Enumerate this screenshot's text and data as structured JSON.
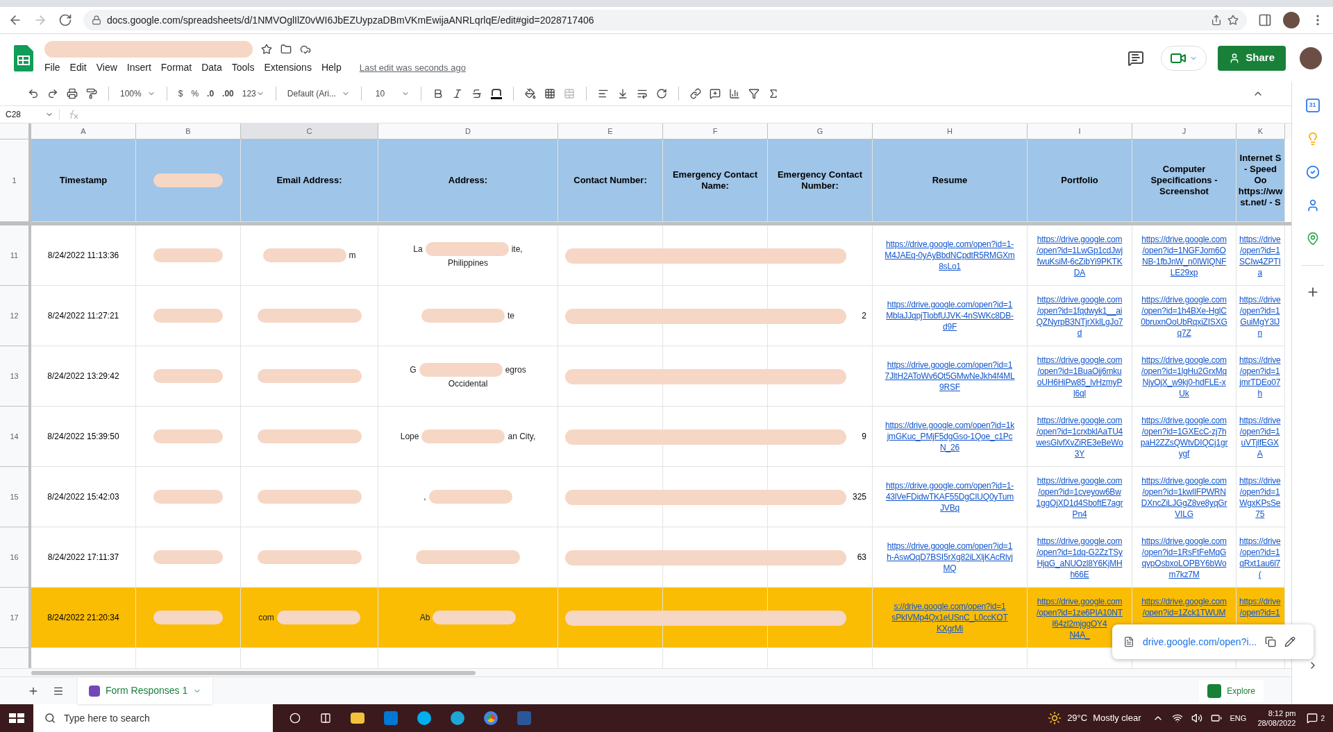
{
  "browser": {
    "url": "docs.google.com/spreadsheets/d/1NMVOglIlZ0vWI6JbEZUypzaDBmVKmEwijaANRLqrlqE/edit#gid=2028717406"
  },
  "doc": {
    "menu": [
      "File",
      "Edit",
      "View",
      "Insert",
      "Format",
      "Data",
      "Tools",
      "Extensions",
      "Help"
    ],
    "last_edit": "Last edit was seconds ago",
    "share": "Share"
  },
  "toolbar": {
    "zoom": "100%",
    "currency": "$",
    "percent": "%",
    "dec_less": ".0",
    "dec_more": ".00",
    "number_format": "123",
    "font": "Default (Ari...",
    "size": "10"
  },
  "formula_bar": {
    "cell": "C28"
  },
  "columns": [
    {
      "label": "A",
      "selected": false
    },
    {
      "label": "B",
      "selected": false
    },
    {
      "label": "C",
      "selected": true
    },
    {
      "label": "D",
      "selected": false
    },
    {
      "label": "E",
      "selected": false
    },
    {
      "label": "F",
      "selected": false
    },
    {
      "label": "G",
      "selected": false
    },
    {
      "label": "H",
      "selected": false
    },
    {
      "label": "I",
      "selected": false
    },
    {
      "label": "J",
      "selected": false
    },
    {
      "label": "K",
      "selected": false
    }
  ],
  "header_row": {
    "number": "1",
    "cells": [
      {
        "kind": "text",
        "lines": [
          "Timestamp"
        ]
      },
      {
        "kind": "redacted"
      },
      {
        "kind": "text",
        "lines": [
          "Email Address:"
        ]
      },
      {
        "kind": "text",
        "lines": [
          "Address:"
        ]
      },
      {
        "kind": "text",
        "lines": [
          "Contact Number:"
        ]
      },
      {
        "kind": "text",
        "lines": [
          "Emergency Contact",
          "Name:"
        ]
      },
      {
        "kind": "text",
        "lines": [
          "Emergency Contact",
          "Number:"
        ]
      },
      {
        "kind": "text",
        "lines": [
          "Resume"
        ]
      },
      {
        "kind": "text",
        "lines": [
          "Portfolio"
        ]
      },
      {
        "kind": "text",
        "lines": [
          "Computer",
          "Specifications -",
          "Screenshot"
        ]
      },
      {
        "kind": "text",
        "lines": [
          "Internet S",
          "- Speed",
          "Oo",
          "https://ww",
          "st.net/ - S"
        ]
      }
    ]
  },
  "rows": [
    {
      "number": "11",
      "highlighted": false,
      "cells": [
        {
          "kind": "text",
          "lines": [
            "8/24/2022 11:13:36"
          ]
        },
        {
          "kind": "redacted"
        },
        {
          "kind": "mixed",
          "lines": [
            {
              "after": "m"
            }
          ]
        },
        {
          "kind": "mixed",
          "lines": [
            {
              "before": "La",
              "after": "ite,"
            },
            {
              "text": "Philippines"
            }
          ]
        },
        {
          "kind": "redacted_span"
        },
        {
          "kind": "empty"
        },
        {
          "kind": "empty"
        },
        {
          "kind": "link",
          "lines": [
            "https://drive.google.com/open?id=1-",
            "M4JAEq-0yAyBbdNCpdtR5RMGXm",
            "8sLo1"
          ]
        },
        {
          "kind": "link",
          "lines": [
            "https://drive.google.com",
            "/open?id=1LwGp1cdJwj",
            "fwuKsiM-6cZibYi9PKTK",
            "DA"
          ]
        },
        {
          "kind": "link",
          "lines": [
            "https://drive.google.com",
            "/open?id=1NGFJom6O",
            "NB-1fbJnW_n0IWIQNF",
            "LE29xp"
          ]
        },
        {
          "kind": "link",
          "lines": [
            "https://drive",
            "/open?id=1",
            "SCIw4ZPTI",
            "a"
          ]
        }
      ]
    },
    {
      "number": "12",
      "highlighted": false,
      "cells": [
        {
          "kind": "text",
          "lines": [
            "8/24/2022 11:27:21"
          ]
        },
        {
          "kind": "redacted"
        },
        {
          "kind": "redacted"
        },
        {
          "kind": "mixed",
          "lines": [
            {
              "after": "te"
            }
          ]
        },
        {
          "kind": "redacted_span"
        },
        {
          "kind": "empty"
        },
        {
          "kind": "text_right",
          "lines": [
            "2"
          ]
        },
        {
          "kind": "link",
          "lines": [
            "https://drive.google.com/open?id=1",
            "MblaJJqpjTlobfUJVK-4nSWKc8DB-",
            "d9F"
          ]
        },
        {
          "kind": "link",
          "lines": [
            "https://drive.google.com",
            "/open?id=1fqdwyk1__ai",
            "QZNyrpB3NTjrXklLgJo7",
            "d"
          ]
        },
        {
          "kind": "link",
          "lines": [
            "https://drive.google.com",
            "/open?id=1h4BXe-HglC",
            "0bruxnOoUbRqxiZISXG",
            "q7Z"
          ]
        },
        {
          "kind": "link",
          "lines": [
            "https://drive",
            "/open?id=1",
            "GuiMgY3lJ",
            "n"
          ]
        }
      ]
    },
    {
      "number": "13",
      "highlighted": false,
      "cells": [
        {
          "kind": "text",
          "lines": [
            "8/24/2022 13:29:42"
          ]
        },
        {
          "kind": "redacted"
        },
        {
          "kind": "redacted"
        },
        {
          "kind": "mixed",
          "lines": [
            {
              "before": "G",
              "after": "egros"
            },
            {
              "text": "Occidental"
            }
          ]
        },
        {
          "kind": "redacted_span"
        },
        {
          "kind": "empty"
        },
        {
          "kind": "empty"
        },
        {
          "kind": "link",
          "lines": [
            "https://drive.google.com/open?id=1",
            "7JltH2AToWv6Ot5GMwNeJkh4f4ML",
            "9RSF"
          ]
        },
        {
          "kind": "link",
          "lines": [
            "https://drive.google.com",
            "/open?id=1BuaOjj6mku",
            "oUH6HiPw85_lvHzmyP",
            "l6ql"
          ]
        },
        {
          "kind": "link",
          "lines": [
            "https://drive.google.com",
            "/open?id=1lgHu2GrxMq",
            "NjyOjX_w9kj0-hdFLE-x",
            "Uk"
          ]
        },
        {
          "kind": "link",
          "lines": [
            "https://drive",
            "/open?id=1",
            "jmrTDEo07",
            "h"
          ]
        }
      ]
    },
    {
      "number": "14",
      "highlighted": false,
      "cells": [
        {
          "kind": "text",
          "lines": [
            "8/24/2022 15:39:50"
          ]
        },
        {
          "kind": "redacted"
        },
        {
          "kind": "redacted"
        },
        {
          "kind": "mixed",
          "lines": [
            {
              "before": "Lope",
              "after": "an City,"
            }
          ]
        },
        {
          "kind": "redacted_span"
        },
        {
          "kind": "empty"
        },
        {
          "kind": "text_right",
          "lines": [
            "9"
          ]
        },
        {
          "kind": "link",
          "lines": [
            "https://drive.google.com/open?id=1k",
            "jmGKuc_PMjF5dgGso-1Qoe_c1Pc",
            "N_26"
          ]
        },
        {
          "kind": "link",
          "lines": [
            "https://drive.google.com",
            "/open?id=1crxbklAaTU4",
            "wesGlvfXvZiRE3eBeWo",
            "3Y"
          ]
        },
        {
          "kind": "link",
          "lines": [
            "https://drive.google.com",
            "/open?id=1GXEcC-zj7h",
            "paH2ZZsQWtvDIQCj1gr",
            "ygf"
          ]
        },
        {
          "kind": "link",
          "lines": [
            "https://drive",
            "/open?id=1",
            "uVTjlfEGX",
            "A"
          ]
        }
      ]
    },
    {
      "number": "15",
      "highlighted": false,
      "cells": [
        {
          "kind": "text",
          "lines": [
            "8/24/2022 15:42:03"
          ]
        },
        {
          "kind": "redacted"
        },
        {
          "kind": "redacted"
        },
        {
          "kind": "mixed",
          "lines": [
            {
              "before": ","
            }
          ]
        },
        {
          "kind": "redacted_span"
        },
        {
          "kind": "empty"
        },
        {
          "kind": "text_right",
          "lines": [
            "325"
          ]
        },
        {
          "kind": "link",
          "lines": [
            "https://drive.google.com/open?id=1-",
            "43lVeFDidwTKAF55DgCIUQ0yTum",
            "JVBq"
          ]
        },
        {
          "kind": "link",
          "lines": [
            "https://drive.google.com",
            "/open?id=1cveyow6Bw",
            "1ggOjXD1d4SboftE7agr",
            "Pn4"
          ]
        },
        {
          "kind": "link",
          "lines": [
            "https://drive.google.com",
            "/open?id=1kwlIFPWRN",
            "DXncZiLJGgZ8ve8yqGr",
            "VILG"
          ]
        },
        {
          "kind": "link",
          "lines": [
            "https://drive",
            "/open?id=1",
            "WgxKPsSe",
            "75"
          ]
        }
      ]
    },
    {
      "number": "16",
      "highlighted": false,
      "cells": [
        {
          "kind": "text",
          "lines": [
            "8/24/2022 17:11:37"
          ]
        },
        {
          "kind": "redacted"
        },
        {
          "kind": "redacted"
        },
        {
          "kind": "redacted"
        },
        {
          "kind": "redacted_span"
        },
        {
          "kind": "empty"
        },
        {
          "kind": "text_right",
          "lines": [
            "63"
          ]
        },
        {
          "kind": "link",
          "lines": [
            "https://drive.google.com/open?id=1",
            "h-AswOqD7BSI5rXg82iLXljKAcRlvj",
            "MQ"
          ]
        },
        {
          "kind": "link",
          "lines": [
            "https://drive.google.com",
            "/open?id=1dq-G2ZzTSy",
            "HjqG_aNUOzl8Y6KjMH",
            "h66E"
          ]
        },
        {
          "kind": "link",
          "lines": [
            "https://drive.google.com",
            "/open?id=1RsFtFeMqG",
            "qvpOsbxoLOPBY6bWo",
            "m7kz7M"
          ]
        },
        {
          "kind": "link",
          "lines": [
            "https://drive",
            "/open?id=1",
            "qRxt1au6l7",
            "("
          ]
        }
      ]
    },
    {
      "number": "17",
      "highlighted": true,
      "cells": [
        {
          "kind": "text",
          "lines": [
            "8/24/2022 21:20:34"
          ]
        },
        {
          "kind": "redacted"
        },
        {
          "kind": "mixed",
          "lines": [
            {
              "before": "com"
            }
          ]
        },
        {
          "kind": "mixed",
          "lines": [
            {
              "before": "Ab"
            }
          ]
        },
        {
          "kind": "redacted_span"
        },
        {
          "kind": "empty"
        },
        {
          "kind": "empty"
        },
        {
          "kind": "link",
          "lines": [
            "s://drive.google.com/open?id=1",
            "sPkIVMp4Qx1eUSnC_L0ccKOT",
            "KXgrMi"
          ]
        },
        {
          "kind": "link",
          "lines": [
            "https://drive.google.com",
            "/open?id=1ze6PIA10NT",
            "l64zl2mjggOY4",
            "N4A_"
          ]
        },
        {
          "kind": "link",
          "lines": [
            "https://drive.google.com",
            "/open?id=1Zck1TWUM"
          ]
        },
        {
          "kind": "link",
          "lines": [
            "https://drive",
            "/open?id=1"
          ]
        }
      ]
    }
  ],
  "link_preview": {
    "text": "drive.google.com/open?i..."
  },
  "sheet_tabs": [
    {
      "label": "Form Responses 1",
      "selected": true
    }
  ],
  "explore": "Explore",
  "side_panel": {
    "calendar_day": "31"
  },
  "taskbar": {
    "search_placeholder": "Type here to search",
    "temperature": "29°C",
    "weather": "Mostly clear",
    "language": "ENG",
    "time": "8:12 pm",
    "date": "28/08/2022",
    "notifications": "2"
  }
}
